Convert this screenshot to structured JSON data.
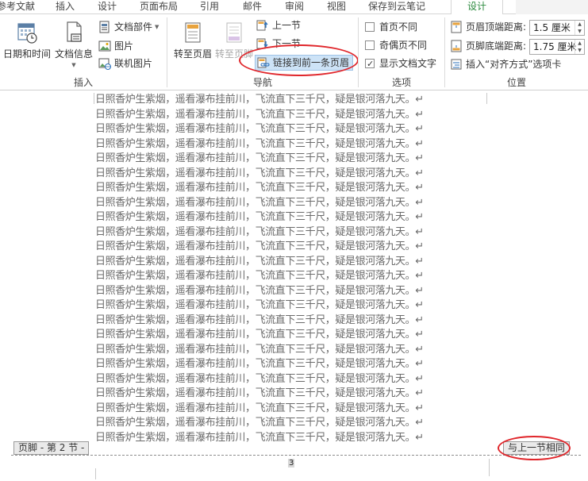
{
  "tabs": [
    {
      "label": "参考文献"
    },
    {
      "label": "插入"
    },
    {
      "label": "设计"
    },
    {
      "label": "页面布局"
    },
    {
      "label": "引用"
    },
    {
      "label": "邮件"
    },
    {
      "label": "审阅"
    },
    {
      "label": "视图"
    },
    {
      "label": "保存到云笔记"
    },
    {
      "label": "设计",
      "active": true
    }
  ],
  "insert_group": {
    "label": "插入",
    "date_time": "日期和时间",
    "doc_info": "文档信息",
    "doc_parts": "文档部件",
    "picture": "图片",
    "online_picture": "联机图片"
  },
  "nav_group": {
    "label": "导航",
    "goto_header": "转至页眉",
    "goto_footer": "转至页脚",
    "prev_section": "上一节",
    "next_section": "下一节",
    "link_previous": "链接到前一条页眉"
  },
  "options_group": {
    "label": "选项",
    "first_page_diff": {
      "label": "首页不同",
      "checked": false
    },
    "odd_even_diff": {
      "label": "奇偶页不同",
      "checked": false
    },
    "show_doc_text": {
      "label": "显示文档文字",
      "checked": true
    }
  },
  "position_group": {
    "label": "位置",
    "header_top_label": "页眉顶端距离:",
    "header_top_value": "1.5 厘米",
    "footer_bottom_label": "页脚底端距离:",
    "footer_bottom_value": "1.75 厘米",
    "insert_align_tab": "插入“对齐方式”选项卡"
  },
  "document": {
    "line_text": "日照香炉生紫烟，遥看瀑布挂前川，飞流直下三千尺，疑是银河落九天。↵",
    "line_count": 24
  },
  "footer": {
    "tag": "页脚 - 第 2 节 -",
    "same_as_previous": "与上一节相同",
    "page_number": "3"
  },
  "colors": {
    "accent_active_tab": "#2b8a3e",
    "annotation_red": "#e0262b"
  }
}
